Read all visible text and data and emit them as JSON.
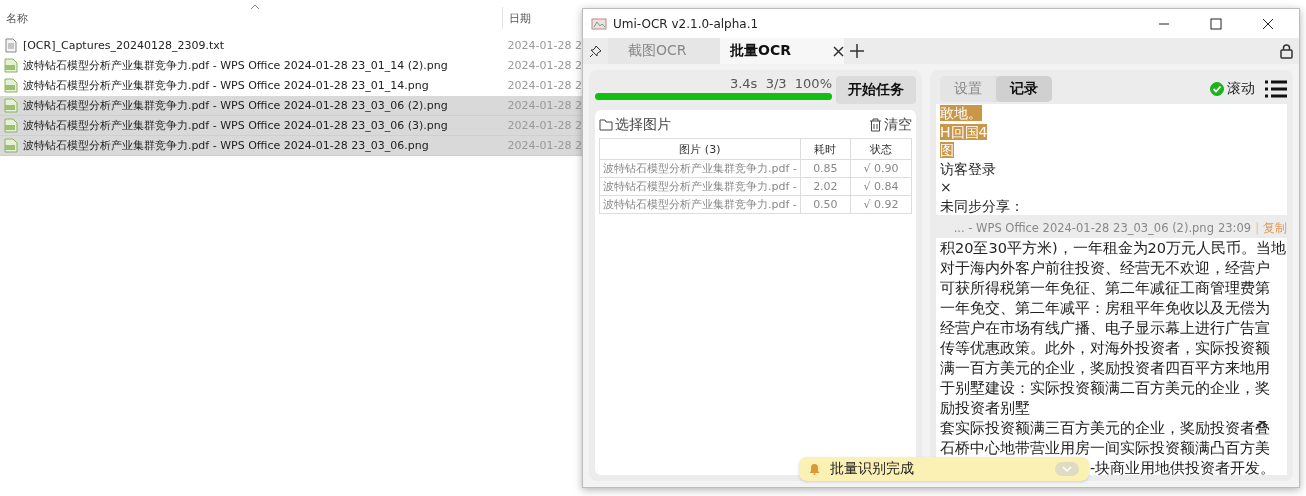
{
  "explorer": {
    "columns": [
      "名称",
      "日期"
    ],
    "files": [
      {
        "kind": "text",
        "name": "[OCR]_Captures_20240128_2309.txt",
        "date": "2024-01-28 2",
        "selected": false
      },
      {
        "kind": "image",
        "name": "波特钻石模型分析产业集群竞争力.pdf - WPS Office 2024-01-28 23_01_14 (2).png",
        "date": "2024-01-28 2",
        "selected": false
      },
      {
        "kind": "image",
        "name": "波特钻石模型分析产业集群竞争力.pdf - WPS Office 2024-01-28 23_01_14.png",
        "date": "2024-01-28 2",
        "selected": false
      },
      {
        "kind": "image",
        "name": "波特钻石模型分析产业集群竞争力.pdf - WPS Office 2024-01-28 23_03_06 (2).png",
        "date": "2024-01-28 2",
        "selected": true
      },
      {
        "kind": "image",
        "name": "波特钻石模型分析产业集群竞争力.pdf - WPS Office 2024-01-28 23_03_06 (3).png",
        "date": "2024-01-28 2",
        "selected": true
      },
      {
        "kind": "image",
        "name": "波特钻石模型分析产业集群竞争力.pdf - WPS Office 2024-01-28 23_03_06.png",
        "date": "2024-01-28 2",
        "selected": true
      }
    ]
  },
  "window": {
    "title": "Umi-OCR v2.1.0-alpha.1",
    "tabs": [
      {
        "label": "截图OCR",
        "selected": false
      },
      {
        "label": "批量OCR",
        "selected": true
      }
    ],
    "task": {
      "stats": "3.4s  3/3  100%",
      "level": 1,
      "start_button": "开始任务",
      "choose_button": "选择图片",
      "clear_button": "清空",
      "table": {
        "columns": [
          "图片 (3)",
          "耗时",
          "状态"
        ],
        "rows": [
          [
            "波特钻石模型分析产业集群竞争力.pdf -",
            "0.85",
            "√ 0.90"
          ],
          [
            "波特钻石模型分析产业集群竞争力.pdf -",
            "2.02",
            "√ 0.84"
          ],
          [
            "波特钻石模型分析产业集群竞争力.pdf -",
            "0.50",
            "√ 0.92"
          ]
        ]
      }
    },
    "results": {
      "tabs": [
        {
          "label": "设置",
          "selected": false
        },
        {
          "label": "记录",
          "selected": true
        }
      ],
      "scroll": {
        "label": "滚动",
        "checked": true
      },
      "first_record": [
        {
          "text": "敢地。",
          "highlighted": true
        },
        {
          "text": "H回国4",
          "highlighted": true
        },
        {
          "text": "图",
          "highlighted": true
        },
        {
          "text": "访客登录",
          "highlighted": false
        },
        {
          "text": "×",
          "highlighted": false
        },
        {
          "text": "未同步分享：",
          "highlighted": false
        }
      ],
      "second_record": {
        "source": "... - WPS Office 2024-01-28 23_03_06 (2).png",
        "time": "23:09",
        "separator": "|",
        "copy": "复制",
        "lines": [
          "积20至30平方米)，一年租金为20万元人民币。当地",
          "对于海内外客户前往投资、经营无不欢迎，经营户",
          "可获所得税第一年免征、第二年减征工商管理费第",
          "一年免交、第二年减平：房租平年免收以及无偿为",
          "经营户在市场有线广播、电子显示幕上进行广告宣",
          "传等优惠政策。此外，对海外投资者，实际投资额",
          "满一百方美元的企业，奖励投资者四百平方来地用",
          "于别墅建设：实际投资额满二百方美元的企业，奖",
          "励投资者别墅",
          "套实际投资额满三百方美元的企业，奖励投资者叠",
          "石桥中心地带营业用房一间实际投资额满凸百方美",
          "-块商业用地供投资者开发。"
        ]
      }
    },
    "toast": {
      "message": "批量识别完成"
    }
  }
}
